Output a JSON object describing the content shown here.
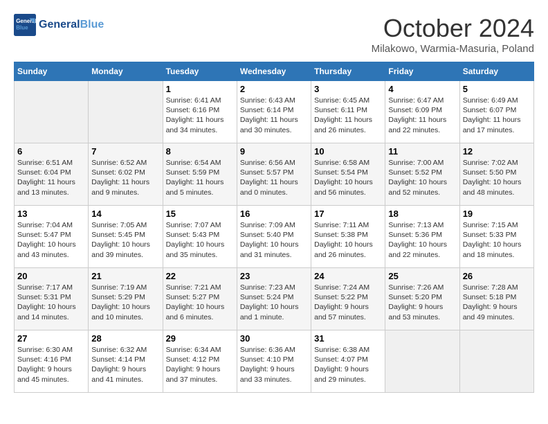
{
  "header": {
    "logo_line1": "General",
    "logo_line2": "Blue",
    "month": "October 2024",
    "location": "Milakowo, Warmia-Masuria, Poland"
  },
  "weekdays": [
    "Sunday",
    "Monday",
    "Tuesday",
    "Wednesday",
    "Thursday",
    "Friday",
    "Saturday"
  ],
  "weeks": [
    [
      {
        "day": "",
        "info": ""
      },
      {
        "day": "",
        "info": ""
      },
      {
        "day": "1",
        "info": "Sunrise: 6:41 AM\nSunset: 6:16 PM\nDaylight: 11 hours and 34 minutes."
      },
      {
        "day": "2",
        "info": "Sunrise: 6:43 AM\nSunset: 6:14 PM\nDaylight: 11 hours and 30 minutes."
      },
      {
        "day": "3",
        "info": "Sunrise: 6:45 AM\nSunset: 6:11 PM\nDaylight: 11 hours and 26 minutes."
      },
      {
        "day": "4",
        "info": "Sunrise: 6:47 AM\nSunset: 6:09 PM\nDaylight: 11 hours and 22 minutes."
      },
      {
        "day": "5",
        "info": "Sunrise: 6:49 AM\nSunset: 6:07 PM\nDaylight: 11 hours and 17 minutes."
      }
    ],
    [
      {
        "day": "6",
        "info": "Sunrise: 6:51 AM\nSunset: 6:04 PM\nDaylight: 11 hours and 13 minutes."
      },
      {
        "day": "7",
        "info": "Sunrise: 6:52 AM\nSunset: 6:02 PM\nDaylight: 11 hours and 9 minutes."
      },
      {
        "day": "8",
        "info": "Sunrise: 6:54 AM\nSunset: 5:59 PM\nDaylight: 11 hours and 5 minutes."
      },
      {
        "day": "9",
        "info": "Sunrise: 6:56 AM\nSunset: 5:57 PM\nDaylight: 11 hours and 0 minutes."
      },
      {
        "day": "10",
        "info": "Sunrise: 6:58 AM\nSunset: 5:54 PM\nDaylight: 10 hours and 56 minutes."
      },
      {
        "day": "11",
        "info": "Sunrise: 7:00 AM\nSunset: 5:52 PM\nDaylight: 10 hours and 52 minutes."
      },
      {
        "day": "12",
        "info": "Sunrise: 7:02 AM\nSunset: 5:50 PM\nDaylight: 10 hours and 48 minutes."
      }
    ],
    [
      {
        "day": "13",
        "info": "Sunrise: 7:04 AM\nSunset: 5:47 PM\nDaylight: 10 hours and 43 minutes."
      },
      {
        "day": "14",
        "info": "Sunrise: 7:05 AM\nSunset: 5:45 PM\nDaylight: 10 hours and 39 minutes."
      },
      {
        "day": "15",
        "info": "Sunrise: 7:07 AM\nSunset: 5:43 PM\nDaylight: 10 hours and 35 minutes."
      },
      {
        "day": "16",
        "info": "Sunrise: 7:09 AM\nSunset: 5:40 PM\nDaylight: 10 hours and 31 minutes."
      },
      {
        "day": "17",
        "info": "Sunrise: 7:11 AM\nSunset: 5:38 PM\nDaylight: 10 hours and 26 minutes."
      },
      {
        "day": "18",
        "info": "Sunrise: 7:13 AM\nSunset: 5:36 PM\nDaylight: 10 hours and 22 minutes."
      },
      {
        "day": "19",
        "info": "Sunrise: 7:15 AM\nSunset: 5:33 PM\nDaylight: 10 hours and 18 minutes."
      }
    ],
    [
      {
        "day": "20",
        "info": "Sunrise: 7:17 AM\nSunset: 5:31 PM\nDaylight: 10 hours and 14 minutes."
      },
      {
        "day": "21",
        "info": "Sunrise: 7:19 AM\nSunset: 5:29 PM\nDaylight: 10 hours and 10 minutes."
      },
      {
        "day": "22",
        "info": "Sunrise: 7:21 AM\nSunset: 5:27 PM\nDaylight: 10 hours and 6 minutes."
      },
      {
        "day": "23",
        "info": "Sunrise: 7:23 AM\nSunset: 5:24 PM\nDaylight: 10 hours and 1 minute."
      },
      {
        "day": "24",
        "info": "Sunrise: 7:24 AM\nSunset: 5:22 PM\nDaylight: 9 hours and 57 minutes."
      },
      {
        "day": "25",
        "info": "Sunrise: 7:26 AM\nSunset: 5:20 PM\nDaylight: 9 hours and 53 minutes."
      },
      {
        "day": "26",
        "info": "Sunrise: 7:28 AM\nSunset: 5:18 PM\nDaylight: 9 hours and 49 minutes."
      }
    ],
    [
      {
        "day": "27",
        "info": "Sunrise: 6:30 AM\nSunset: 4:16 PM\nDaylight: 9 hours and 45 minutes."
      },
      {
        "day": "28",
        "info": "Sunrise: 6:32 AM\nSunset: 4:14 PM\nDaylight: 9 hours and 41 minutes."
      },
      {
        "day": "29",
        "info": "Sunrise: 6:34 AM\nSunset: 4:12 PM\nDaylight: 9 hours and 37 minutes."
      },
      {
        "day": "30",
        "info": "Sunrise: 6:36 AM\nSunset: 4:10 PM\nDaylight: 9 hours and 33 minutes."
      },
      {
        "day": "31",
        "info": "Sunrise: 6:38 AM\nSunset: 4:07 PM\nDaylight: 9 hours and 29 minutes."
      },
      {
        "day": "",
        "info": ""
      },
      {
        "day": "",
        "info": ""
      }
    ]
  ]
}
